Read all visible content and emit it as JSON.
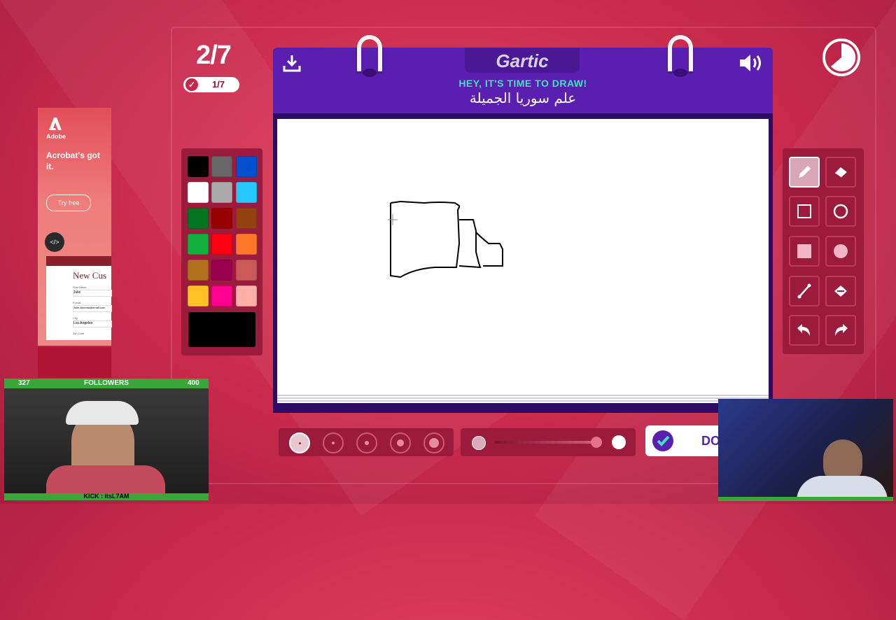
{
  "round": {
    "current": "2/7",
    "done_count": "1/7"
  },
  "header": {
    "logo": "Gartic",
    "subtitle": "HEY, IT'S TIME TO DRAW!",
    "word": "علم سوريا الجميلة"
  },
  "icons": {
    "download": "download-icon",
    "sound": "speaker-icon",
    "timer": "timer-icon"
  },
  "palette": {
    "colors": [
      "#000000",
      "#666666",
      "#0050cd",
      "#ffffff",
      "#aaaaaa",
      "#26c9ff",
      "#017420",
      "#990000",
      "#964112",
      "#11b03c",
      "#ff0013",
      "#ff7829",
      "#b0701c",
      "#99004e",
      "#cb5a57",
      "#ffc126",
      "#ff008f",
      "#feafa8"
    ],
    "current": "#000000"
  },
  "tools": [
    "pencil",
    "eraser",
    "rectangle-outline",
    "circle-outline",
    "rectangle-filled",
    "circle-filled",
    "line",
    "fill-bucket",
    "undo",
    "redo"
  ],
  "brush_sizes": 5,
  "done_button": {
    "label": "DO"
  },
  "ad": {
    "brand": "Adobe",
    "headline": "Acrobat's got it.",
    "cta": "Try free",
    "form_title": "New Cus",
    "field1_label": "First Name",
    "field1_value": "Julie",
    "field2_label": "E-mail",
    "field2_value": "Julie.Amenta@email.com",
    "field3_label": "City",
    "field3_value": "Los Angeles",
    "field4_label": "Zip Code"
  },
  "stream": {
    "followers_left": "327",
    "followers_label": "FOLLOWERS",
    "followers_right": "400",
    "kick_handle": "KICK : itsL7AM"
  }
}
